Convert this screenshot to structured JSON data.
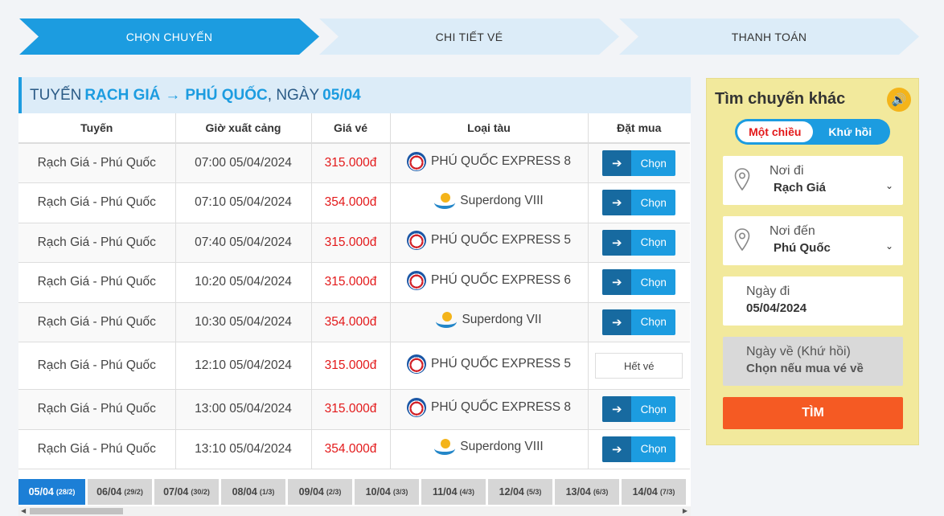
{
  "steps": [
    "CHỌN CHUYẾN",
    "CHI TIẾT VÉ",
    "THANH TOÁN"
  ],
  "route_header": {
    "prefix": "TUYẾN",
    "from": "RẠCH GIÁ",
    "arrow": "→",
    "to": "PHÚ QUỐC",
    "date_label": ", NGÀY",
    "date": "05/04"
  },
  "table": {
    "headers": [
      "Tuyến",
      "Giờ xuất cảng",
      "Giá vé",
      "Loại tàu",
      "Đặt mua"
    ],
    "rows": [
      {
        "route": "Rạch Giá - Phú Quốc",
        "time": "07:00 05/04/2024",
        "price": "315.000đ",
        "vessel": "PHÚ QUỐC EXPRESS 8",
        "logo": "pqexpress-logo-icon",
        "action": "Chọn"
      },
      {
        "route": "Rạch Giá - Phú Quốc",
        "time": "07:10 05/04/2024",
        "price": "354.000đ",
        "vessel": "Superdong VIII",
        "logo": "superdong-logo-icon",
        "action": "Chọn"
      },
      {
        "route": "Rạch Giá - Phú Quốc",
        "time": "07:40 05/04/2024",
        "price": "315.000đ",
        "vessel": "PHÚ QUỐC EXPRESS 5",
        "logo": "pqexpress-logo-icon",
        "action": "Chọn"
      },
      {
        "route": "Rạch Giá - Phú Quốc",
        "time": "10:20 05/04/2024",
        "price": "315.000đ",
        "vessel": "PHÚ QUỐC EXPRESS 6",
        "logo": "pqexpress-logo-icon",
        "action": "Chọn"
      },
      {
        "route": "Rạch Giá - Phú Quốc",
        "time": "10:30 05/04/2024",
        "price": "354.000đ",
        "vessel": "Superdong VII",
        "logo": "superdong-logo-icon",
        "action": "Chọn"
      },
      {
        "route": "Rạch Giá - Phú Quốc",
        "time": "12:10 05/04/2024",
        "price": "315.000đ",
        "vessel": "PHÚ QUỐC EXPRESS 5",
        "logo": "pqexpress-logo-icon",
        "action": "Hết vé"
      },
      {
        "route": "Rạch Giá - Phú Quốc",
        "time": "13:00 05/04/2024",
        "price": "315.000đ",
        "vessel": "PHÚ QUỐC EXPRESS 8",
        "logo": "pqexpress-logo-icon",
        "action": "Chọn"
      },
      {
        "route": "Rạch Giá - Phú Quốc",
        "time": "13:10 05/04/2024",
        "price": "354.000đ",
        "vessel": "Superdong VIII",
        "logo": "superdong-logo-icon",
        "action": "Chọn"
      }
    ]
  },
  "date_tabs": [
    {
      "date": "05/04",
      "day": "(28/2)",
      "active": true
    },
    {
      "date": "06/04",
      "day": "(29/2)"
    },
    {
      "date": "07/04",
      "day": "(30/2)"
    },
    {
      "date": "08/04",
      "day": "(1/3)"
    },
    {
      "date": "09/04",
      "day": "(2/3)"
    },
    {
      "date": "10/04",
      "day": "(3/3)"
    },
    {
      "date": "11/04",
      "day": "(4/3)"
    },
    {
      "date": "12/04",
      "day": "(5/3)"
    },
    {
      "date": "13/04",
      "day": "(6/3)"
    },
    {
      "date": "14/04",
      "day": "(7/3)"
    }
  ],
  "search": {
    "title": "Tìm chuyến khác",
    "sound_icon": "speaker-icon",
    "toggle": {
      "one_way": "Một chiều",
      "round_trip": "Khứ hồi"
    },
    "from_label": "Nơi đi",
    "from_value": "Rạch Giá",
    "to_label": "Nơi đến",
    "to_value": "Phú Quốc",
    "depart_label": "Ngày đi",
    "depart_value": "05/04/2024",
    "return_label": "Ngày về (Khứ hồi)",
    "return_value": "Chọn nếu mua vé về",
    "submit": "TÌM"
  },
  "colors": {
    "primary": "#1c9ce0",
    "price": "#e3191a",
    "search_bg": "#f2e99c",
    "submit": "#f55a23"
  }
}
